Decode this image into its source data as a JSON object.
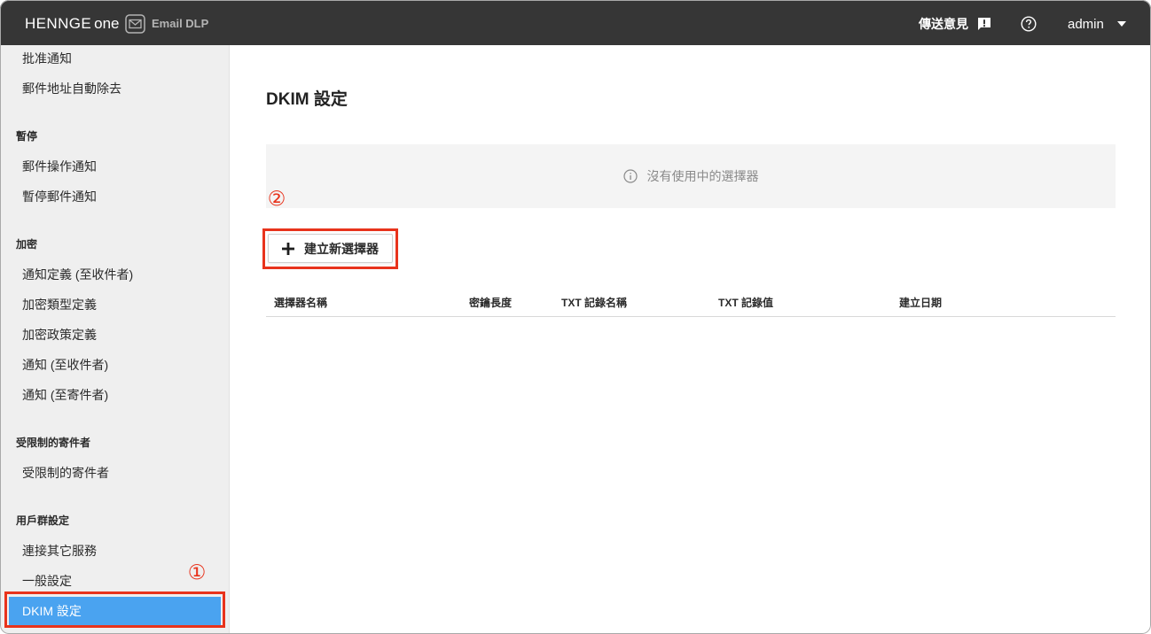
{
  "header": {
    "logo_primary": "HENNGE",
    "logo_secondary": "one",
    "product": "Email DLP",
    "feedback_label": "傳送意見",
    "user_name": "admin",
    "icons": {
      "product": "mail-icon",
      "feedback": "feedback-icon",
      "help": "help-icon",
      "user_menu": "caret-down-icon"
    }
  },
  "sidebar": {
    "groups": [
      {
        "items": [
          {
            "label": "批准通知"
          },
          {
            "label": "郵件地址自動除去"
          }
        ]
      },
      {
        "heading": "暫停",
        "items": [
          {
            "label": "郵件操作通知"
          },
          {
            "label": "暫停郵件通知"
          }
        ]
      },
      {
        "heading": "加密",
        "items": [
          {
            "label": "通知定義 (至收件者)"
          },
          {
            "label": "加密類型定義"
          },
          {
            "label": "加密政策定義"
          },
          {
            "label": "通知 (至收件者)"
          },
          {
            "label": "通知 (至寄件者)"
          }
        ]
      },
      {
        "heading": "受限制的寄件者",
        "items": [
          {
            "label": "受限制的寄件者"
          }
        ]
      },
      {
        "heading": "用戶群設定",
        "items": [
          {
            "label": "連接其它服務"
          },
          {
            "label": "一般設定"
          },
          {
            "label": "DKIM 設定",
            "active": true
          }
        ]
      }
    ]
  },
  "main": {
    "title": "DKIM 設定",
    "empty_icon": "info-icon",
    "empty_message": "沒有使用中的選擇器",
    "create_button_icon": "plus-icon",
    "create_button_label": "建立新選擇器",
    "table": {
      "columns": [
        "選擇器名稱",
        "密鑰長度",
        "TXT 記錄名稱",
        "TXT 記錄值",
        "建立日期"
      ],
      "rows": []
    }
  },
  "annotations": {
    "step1": "①",
    "step2": "②"
  },
  "colors": {
    "header_bg": "#363636",
    "sidebar_bg": "#efefef",
    "active_bg": "#4aa3f0",
    "annotation": "#e8331c"
  }
}
